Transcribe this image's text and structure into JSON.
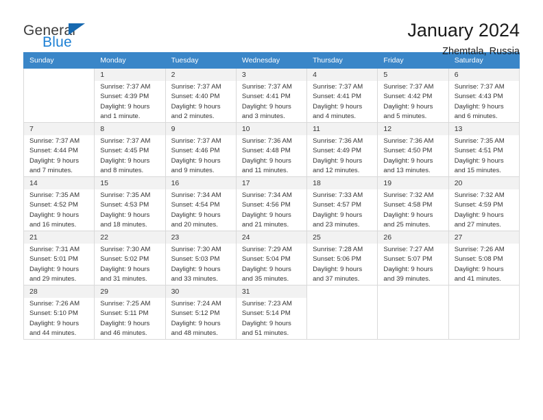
{
  "brand": {
    "name_top": "General",
    "name_bottom": "Blue",
    "flag_icon": "triangle-flag-icon",
    "accent_color": "#1b7fd4"
  },
  "header": {
    "title": "January 2024",
    "location": "Zhemtala, Russia"
  },
  "calendar": {
    "header_bg": "#3a86c8",
    "weekdays": [
      "Sunday",
      "Monday",
      "Tuesday",
      "Wednesday",
      "Thursday",
      "Friday",
      "Saturday"
    ],
    "weeks": [
      [
        {
          "day": "",
          "sunrise": "",
          "sunset": "",
          "daylight": "",
          "daylight2": ""
        },
        {
          "day": "1",
          "sunrise": "Sunrise: 7:37 AM",
          "sunset": "Sunset: 4:39 PM",
          "daylight": "Daylight: 9 hours",
          "daylight2": "and 1 minute."
        },
        {
          "day": "2",
          "sunrise": "Sunrise: 7:37 AM",
          "sunset": "Sunset: 4:40 PM",
          "daylight": "Daylight: 9 hours",
          "daylight2": "and 2 minutes."
        },
        {
          "day": "3",
          "sunrise": "Sunrise: 7:37 AM",
          "sunset": "Sunset: 4:41 PM",
          "daylight": "Daylight: 9 hours",
          "daylight2": "and 3 minutes."
        },
        {
          "day": "4",
          "sunrise": "Sunrise: 7:37 AM",
          "sunset": "Sunset: 4:41 PM",
          "daylight": "Daylight: 9 hours",
          "daylight2": "and 4 minutes."
        },
        {
          "day": "5",
          "sunrise": "Sunrise: 7:37 AM",
          "sunset": "Sunset: 4:42 PM",
          "daylight": "Daylight: 9 hours",
          "daylight2": "and 5 minutes."
        },
        {
          "day": "6",
          "sunrise": "Sunrise: 7:37 AM",
          "sunset": "Sunset: 4:43 PM",
          "daylight": "Daylight: 9 hours",
          "daylight2": "and 6 minutes."
        }
      ],
      [
        {
          "day": "7",
          "sunrise": "Sunrise: 7:37 AM",
          "sunset": "Sunset: 4:44 PM",
          "daylight": "Daylight: 9 hours",
          "daylight2": "and 7 minutes."
        },
        {
          "day": "8",
          "sunrise": "Sunrise: 7:37 AM",
          "sunset": "Sunset: 4:45 PM",
          "daylight": "Daylight: 9 hours",
          "daylight2": "and 8 minutes."
        },
        {
          "day": "9",
          "sunrise": "Sunrise: 7:37 AM",
          "sunset": "Sunset: 4:46 PM",
          "daylight": "Daylight: 9 hours",
          "daylight2": "and 9 minutes."
        },
        {
          "day": "10",
          "sunrise": "Sunrise: 7:36 AM",
          "sunset": "Sunset: 4:48 PM",
          "daylight": "Daylight: 9 hours",
          "daylight2": "and 11 minutes."
        },
        {
          "day": "11",
          "sunrise": "Sunrise: 7:36 AM",
          "sunset": "Sunset: 4:49 PM",
          "daylight": "Daylight: 9 hours",
          "daylight2": "and 12 minutes."
        },
        {
          "day": "12",
          "sunrise": "Sunrise: 7:36 AM",
          "sunset": "Sunset: 4:50 PM",
          "daylight": "Daylight: 9 hours",
          "daylight2": "and 13 minutes."
        },
        {
          "day": "13",
          "sunrise": "Sunrise: 7:35 AM",
          "sunset": "Sunset: 4:51 PM",
          "daylight": "Daylight: 9 hours",
          "daylight2": "and 15 minutes."
        }
      ],
      [
        {
          "day": "14",
          "sunrise": "Sunrise: 7:35 AM",
          "sunset": "Sunset: 4:52 PM",
          "daylight": "Daylight: 9 hours",
          "daylight2": "and 16 minutes."
        },
        {
          "day": "15",
          "sunrise": "Sunrise: 7:35 AM",
          "sunset": "Sunset: 4:53 PM",
          "daylight": "Daylight: 9 hours",
          "daylight2": "and 18 minutes."
        },
        {
          "day": "16",
          "sunrise": "Sunrise: 7:34 AM",
          "sunset": "Sunset: 4:54 PM",
          "daylight": "Daylight: 9 hours",
          "daylight2": "and 20 minutes."
        },
        {
          "day": "17",
          "sunrise": "Sunrise: 7:34 AM",
          "sunset": "Sunset: 4:56 PM",
          "daylight": "Daylight: 9 hours",
          "daylight2": "and 21 minutes."
        },
        {
          "day": "18",
          "sunrise": "Sunrise: 7:33 AM",
          "sunset": "Sunset: 4:57 PM",
          "daylight": "Daylight: 9 hours",
          "daylight2": "and 23 minutes."
        },
        {
          "day": "19",
          "sunrise": "Sunrise: 7:32 AM",
          "sunset": "Sunset: 4:58 PM",
          "daylight": "Daylight: 9 hours",
          "daylight2": "and 25 minutes."
        },
        {
          "day": "20",
          "sunrise": "Sunrise: 7:32 AM",
          "sunset": "Sunset: 4:59 PM",
          "daylight": "Daylight: 9 hours",
          "daylight2": "and 27 minutes."
        }
      ],
      [
        {
          "day": "21",
          "sunrise": "Sunrise: 7:31 AM",
          "sunset": "Sunset: 5:01 PM",
          "daylight": "Daylight: 9 hours",
          "daylight2": "and 29 minutes."
        },
        {
          "day": "22",
          "sunrise": "Sunrise: 7:30 AM",
          "sunset": "Sunset: 5:02 PM",
          "daylight": "Daylight: 9 hours",
          "daylight2": "and 31 minutes."
        },
        {
          "day": "23",
          "sunrise": "Sunrise: 7:30 AM",
          "sunset": "Sunset: 5:03 PM",
          "daylight": "Daylight: 9 hours",
          "daylight2": "and 33 minutes."
        },
        {
          "day": "24",
          "sunrise": "Sunrise: 7:29 AM",
          "sunset": "Sunset: 5:04 PM",
          "daylight": "Daylight: 9 hours",
          "daylight2": "and 35 minutes."
        },
        {
          "day": "25",
          "sunrise": "Sunrise: 7:28 AM",
          "sunset": "Sunset: 5:06 PM",
          "daylight": "Daylight: 9 hours",
          "daylight2": "and 37 minutes."
        },
        {
          "day": "26",
          "sunrise": "Sunrise: 7:27 AM",
          "sunset": "Sunset: 5:07 PM",
          "daylight": "Daylight: 9 hours",
          "daylight2": "and 39 minutes."
        },
        {
          "day": "27",
          "sunrise": "Sunrise: 7:26 AM",
          "sunset": "Sunset: 5:08 PM",
          "daylight": "Daylight: 9 hours",
          "daylight2": "and 41 minutes."
        }
      ],
      [
        {
          "day": "28",
          "sunrise": "Sunrise: 7:26 AM",
          "sunset": "Sunset: 5:10 PM",
          "daylight": "Daylight: 9 hours",
          "daylight2": "and 44 minutes."
        },
        {
          "day": "29",
          "sunrise": "Sunrise: 7:25 AM",
          "sunset": "Sunset: 5:11 PM",
          "daylight": "Daylight: 9 hours",
          "daylight2": "and 46 minutes."
        },
        {
          "day": "30",
          "sunrise": "Sunrise: 7:24 AM",
          "sunset": "Sunset: 5:12 PM",
          "daylight": "Daylight: 9 hours",
          "daylight2": "and 48 minutes."
        },
        {
          "day": "31",
          "sunrise": "Sunrise: 7:23 AM",
          "sunset": "Sunset: 5:14 PM",
          "daylight": "Daylight: 9 hours",
          "daylight2": "and 51 minutes."
        },
        {
          "day": "",
          "sunrise": "",
          "sunset": "",
          "daylight": "",
          "daylight2": ""
        },
        {
          "day": "",
          "sunrise": "",
          "sunset": "",
          "daylight": "",
          "daylight2": ""
        },
        {
          "day": "",
          "sunrise": "",
          "sunset": "",
          "daylight": "",
          "daylight2": ""
        }
      ]
    ]
  }
}
